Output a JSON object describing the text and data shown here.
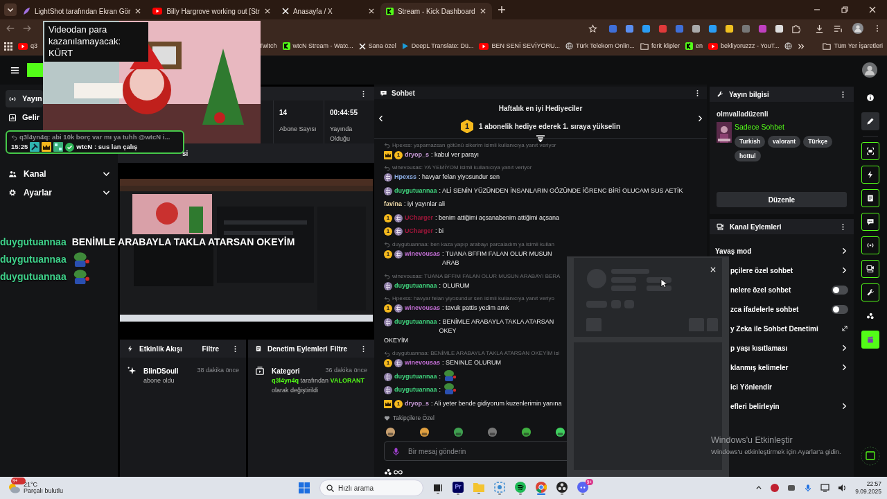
{
  "browser": {
    "tabs": [
      {
        "title": "LightShot tarafından Ekran Gör",
        "selected": false
      },
      {
        "title": "Billy Hargrove working out [Str",
        "selected": false
      },
      {
        "title": "Anasayfa / X",
        "selected": false
      },
      {
        "title": "Stream - Kick Dashboard",
        "selected": true
      }
    ],
    "bookmarks": [
      {
        "label": "q3"
      },
      {
        "label": "Twitch"
      },
      {
        "label": "wtcN Stream - Watc..."
      },
      {
        "label": "Sana özel"
      },
      {
        "label": "DeepL Translate: Dü..."
      },
      {
        "label": "BEN SENİ SEVİYORU..."
      },
      {
        "label": "Türk Telekom Onlin..."
      },
      {
        "label": "ferit klipler"
      },
      {
        "label": "en"
      },
      {
        "label": "bekliyoruzzz - YouT..."
      }
    ],
    "all_bookmarks": "Tüm Yer İşaretleri"
  },
  "video_overlay": {
    "kind": "picture",
    "caption": "Videodan para kazanılamayacak: KÜRT"
  },
  "chat_alert": {
    "reply": "q3l4yn4q: abi 10k borç var mı ya tuhh @wtcN i...",
    "time": "15:25",
    "user": "wtcN",
    "text": ": sus lan çalış"
  },
  "screen_chat": [
    {
      "user": "duygutuannaa",
      "kind": "text",
      "text": "BENİMLE ARABAYLA TAKLA ATARSAN OKEYİM"
    },
    {
      "user": "duygutuannaa",
      "kind": "emote"
    },
    {
      "user": "duygutuannaa",
      "kind": "emote"
    }
  ],
  "sidebar": {
    "items": [
      {
        "label": "Yayın",
        "selected": true
      },
      {
        "label": "Gelir",
        "selected": false
      },
      {
        "label": "Kanal",
        "selected": false,
        "expanded": false
      },
      {
        "label": "Ayarlar",
        "selected": false,
        "expanded": false
      }
    ]
  },
  "stats": [
    {
      "value": "14",
      "label": "Abone Sayısı"
    },
    {
      "value": "00:44:55",
      "label": "Yayında Olduğu"
    }
  ],
  "preview": {
    "title": "si",
    "kind": "picture"
  },
  "activity": {
    "title": "Etkinlik Akışı",
    "filter": "Filtre",
    "events": [
      {
        "user": "BlinDSoull",
        "text": "abone oldu",
        "time": "38 dakika önce"
      }
    ]
  },
  "moderation": {
    "title": "Denetim Eylemleri",
    "filter": "Filtre",
    "events": [
      {
        "title": "Kategori",
        "time": "36 dakika önce",
        "text": "**q3l4yn4q** tarafından **VALORANT** olarak değiştirildi"
      }
    ]
  },
  "chat": {
    "title": "Sohbet",
    "gifters_title": "Haftalık en iyi Hediyeciler",
    "gifter_rank": "1",
    "gifters_text": "1 abonelik hediye ederek 1. sıraya yükselin",
    "messages": [
      {
        "reply": "Hpexss: yapamazsan götünü sikerim isimli kullanıcıya yanıt veriyor",
        "badges": [
          {
            "kind": "crown"
          },
          {
            "kind": "sub",
            "label": "1"
          }
        ],
        "user": "dryop_s",
        "color": "#c99bd8",
        "text": ": kabul ver parayı"
      },
      {
        "reply": "winevousas: YA YEMİYOM isimli kullanıcıya yanıt veriyor",
        "badges": [
          {
            "kind": "globe"
          }
        ],
        "user": "Hpexss",
        "color": "#8eb0e8",
        "text": ": havyar felan yiyosundur sen"
      },
      {
        "badges": [
          {
            "kind": "globe"
          }
        ],
        "user": "duygutuannaa",
        "color": "#41d77f",
        "text": ": ALİ SENİN YÜZÜNDEN İNSANLARIN GÖZÜNDE İĞRENC BİRİ OLUCAM SUS AETİK"
      },
      {
        "user": "favina",
        "color": "#f1dcaa",
        "text": ": iyi yayınlar ali"
      },
      {
        "badges": [
          {
            "kind": "sub",
            "label": "1"
          },
          {
            "kind": "globe"
          }
        ],
        "user": "UCharger",
        "color": "#a0163a",
        "text": ": benim attiğimi açsanabenim attiğimi açsana"
      },
      {
        "badges": [
          {
            "kind": "sub",
            "label": "1"
          },
          {
            "kind": "globe"
          }
        ],
        "user": "UCharger",
        "color": "#a0163a",
        "text": ": bi"
      },
      {
        "reply": "duygutuannaa: ben kaza yapıp arabayı parcaladım ya isimli kullan",
        "badges": [
          {
            "kind": "sub",
            "label": "1"
          },
          {
            "kind": "globe"
          }
        ],
        "user": "winevousas",
        "color": "#c46fd6",
        "text": ": TUANA BFFIM FALAN OLUR MUSUN ARAB"
      },
      {
        "reply": "winevousas: TUANA BFFIM FALAN OLUR MUSUN ARABAYI BERA",
        "badges": [
          {
            "kind": "globe"
          }
        ],
        "user": "duygutuannaa",
        "color": "#41d77f",
        "text": ": OLURUM"
      },
      {
        "reply": "Hpexss: havyar felan yiyosundur sen isimli kullanıcıya yanıt veriyo",
        "badges": [
          {
            "kind": "sub",
            "label": "1"
          },
          {
            "kind": "globe"
          }
        ],
        "user": "winevousas",
        "color": "#c46fd6",
        "text": ": tavuk pattis yedim amk"
      },
      {
        "badges": [
          {
            "kind": "globe"
          }
        ],
        "user": "duygutuannaa",
        "color": "#41d77f",
        "text": ": BENİMLE ARABAYLA TAKLA ATARSAN OKEY",
        "wrap": "OKEYİM"
      },
      {
        "reply": "duygutuannaa: BENİMLE ARABAYLA TAKLA ATARSAN OKEYİM isi",
        "badges": [
          {
            "kind": "sub",
            "label": "1"
          },
          {
            "kind": "globe"
          }
        ],
        "user": "winevousas",
        "color": "#c46fd6",
        "text": ": SENINLE OLURUM"
      },
      {
        "badges": [
          {
            "kind": "globe"
          }
        ],
        "user": "duygutuannaa",
        "color": "#41d77f",
        "text": ":",
        "emote": true
      },
      {
        "badges": [
          {
            "kind": "globe"
          }
        ],
        "user": "duygutuannaa",
        "color": "#41d77f",
        "text": ":",
        "emote": true
      },
      {
        "badges": [
          {
            "kind": "crown"
          },
          {
            "kind": "sub",
            "label": "1"
          }
        ],
        "user": "dryop_s",
        "color": "#c99bd8",
        "text": ": Ali yeter bende gidiyorum kuzenlerimin yanına"
      }
    ],
    "emote_section": "Takipçilere Özel",
    "input": {
      "placeholder": "Bir mesaj gönderin"
    }
  },
  "stream_info": {
    "title": "Yayın bilgisi",
    "stream_title": "olmvalladüzenli",
    "category": "Sadece Sohbet",
    "tags": [
      "Turkish",
      "valorant",
      "Türkçe",
      "hottul"
    ],
    "edit_button": "Düzenle"
  },
  "channel_actions": {
    "title": "Kanal Eylemleri",
    "items": [
      {
        "label": "Yavaş mod",
        "kind": "chevron"
      },
      {
        "label": "pçilere özel sohbet",
        "kind": "chevron"
      },
      {
        "label": "nelere özel sohbet",
        "kind": "toggle",
        "on": false
      },
      {
        "label": "zca ifadelerle sohbet",
        "kind": "toggle",
        "on": false
      },
      {
        "label": "y Zeka ile Sohbet Denetimi",
        "kind": "external"
      },
      {
        "label": "p yaşı kısıtlaması",
        "kind": "chevron"
      },
      {
        "label": "klanmış kelimeler",
        "kind": "chevron"
      },
      {
        "label": "ici Yönlendir",
        "kind": "plain"
      },
      {
        "label": "efleri belirleyin",
        "kind": "chevron"
      }
    ]
  },
  "rail": [
    {
      "kind": "plain",
      "selected": false
    },
    {
      "kind": "plain",
      "selected": true
    },
    {
      "kind": "outlined",
      "selected": false
    },
    {
      "kind": "outlined",
      "selected": false
    },
    {
      "kind": "outlined",
      "selected": false
    },
    {
      "kind": "outlined",
      "selected": false
    },
    {
      "kind": "outlined",
      "selected": false
    },
    {
      "kind": "outlined",
      "selected": false
    },
    {
      "kind": "outlined",
      "selected": false
    },
    {
      "kind": "plain",
      "selected": false
    },
    {
      "kind": "filled",
      "selected": false
    }
  ],
  "windows_notice": {
    "title": "Windows'u Etkinleştir",
    "text": "Windows'u etkinleştirmek için Ayarlar'a gidin."
  },
  "taskbar": {
    "weather": {
      "temp": "21°C",
      "text": "Parçalı bulutlu",
      "badge": "9+"
    },
    "search": {
      "placeholder": "Hızlı arama"
    },
    "apps": [
      {
        "active": false
      },
      {
        "label": "Pr",
        "active": false
      },
      {
        "active": false
      },
      {
        "active": false
      },
      {
        "active": false
      },
      {
        "active": true
      },
      {
        "active": false
      },
      {
        "badge": "9+",
        "active": false
      }
    ],
    "time": "22:57",
    "date": "9.09.2025"
  }
}
